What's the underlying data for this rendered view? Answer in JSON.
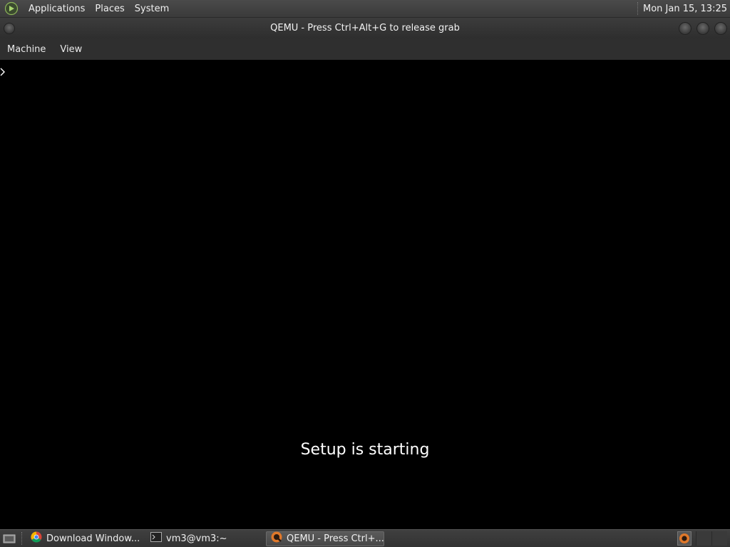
{
  "top_panel": {
    "menus": [
      "Applications",
      "Places",
      "System"
    ],
    "clock": "Mon Jan 15, 13:25"
  },
  "window": {
    "title": "QEMU - Press Ctrl+Alt+G to release grab",
    "menubar": [
      "Machine",
      "View"
    ]
  },
  "vm": {
    "message": "Setup is starting"
  },
  "taskbar": {
    "tasks": [
      {
        "label": "Download Window...",
        "icon": "chrome-icon"
      },
      {
        "label": "vm3@vm3:~",
        "icon": "terminal-icon"
      },
      {
        "label": "QEMU - Press Ctrl+...",
        "icon": "qemu-icon"
      }
    ]
  },
  "colors": {
    "panel": "#3a3a3a",
    "vm_background": "#000000",
    "text": "#ffffff"
  }
}
